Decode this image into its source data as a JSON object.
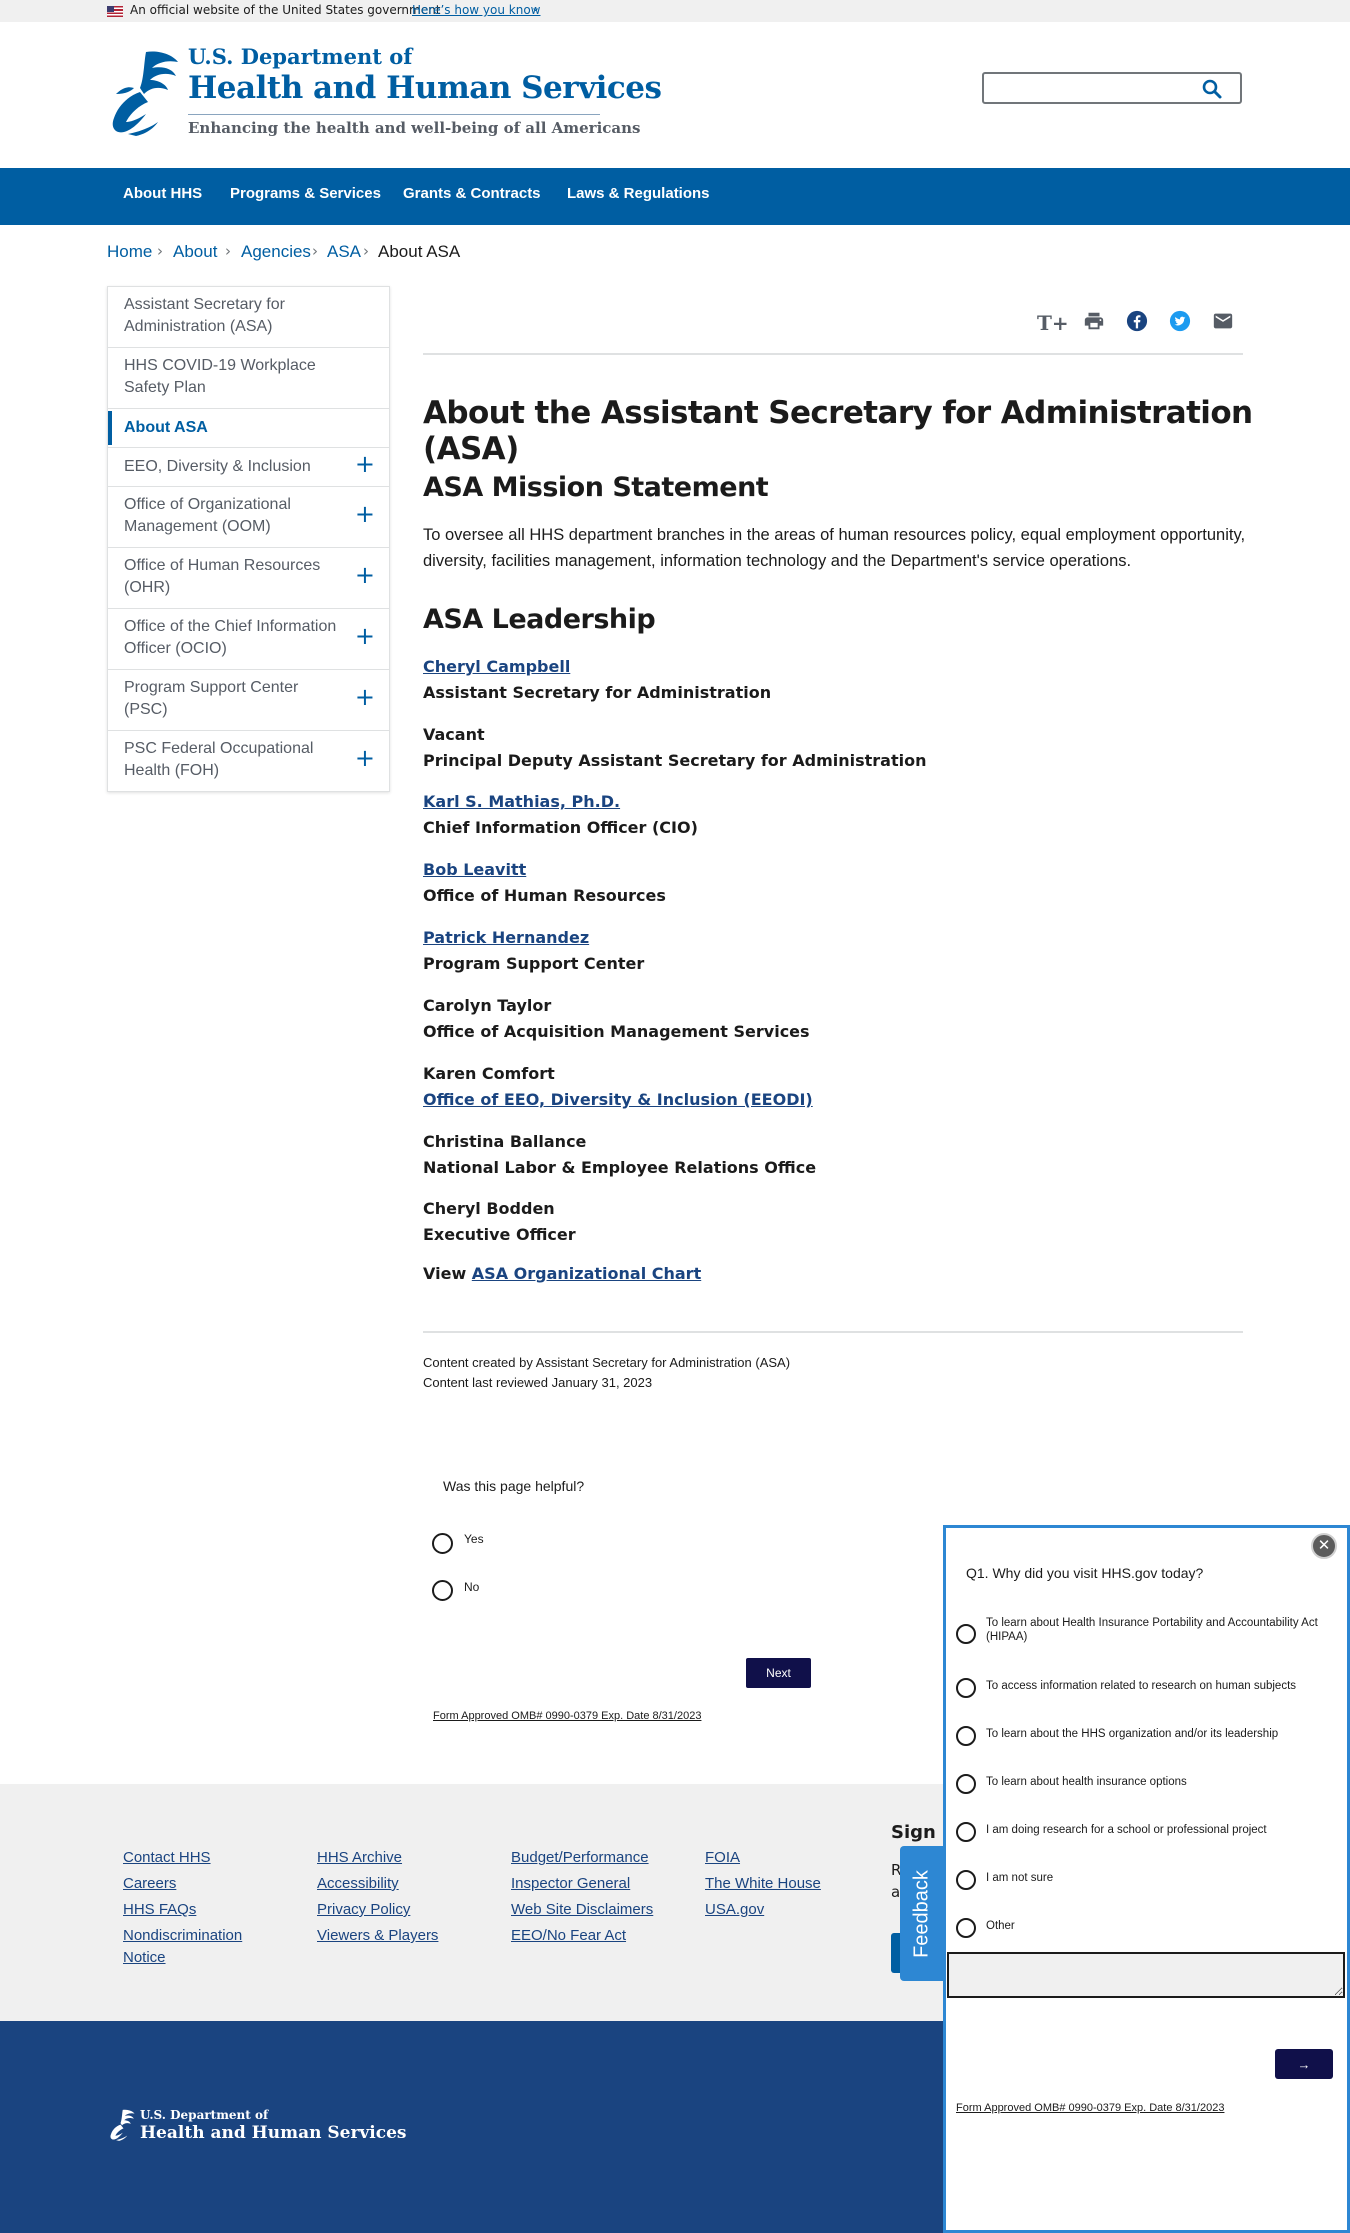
{
  "gov_banner": {
    "text": "An official website of the United States government",
    "link": "Here’s how you know",
    "chevron": "⌄"
  },
  "header": {
    "logo_line1": "U.S. Department of",
    "logo_line2": "Health and Human Services",
    "tagline": "Enhancing the health and well-being of all Americans",
    "search_placeholder": ""
  },
  "nav": {
    "items": [
      "About HHS",
      "Programs & Services",
      "Grants & Contracts",
      "Laws & Regulations"
    ]
  },
  "breadcrumb": {
    "items": [
      "Home",
      "About",
      "Agencies",
      "ASA"
    ],
    "separator": "›",
    "current": "About ASA"
  },
  "sidenav": {
    "items": [
      {
        "label": "Assistant Secretary for Administration (ASA)",
        "expandable": false
      },
      {
        "label": "HHS COVID-19 Workplace Safety Plan",
        "expandable": false
      },
      {
        "label": "About ASA",
        "expandable": false,
        "current": true
      },
      {
        "label": "EEO, Diversity & Inclusion",
        "expandable": true
      },
      {
        "label": "Office of Organizational Management (OOM)",
        "expandable": true
      },
      {
        "label": "Office of Human Resources (OHR)",
        "expandable": true
      },
      {
        "label": "Office of the Chief Information Officer (OCIO)",
        "expandable": true
      },
      {
        "label": "Program Support Center (PSC)",
        "expandable": true
      },
      {
        "label": "PSC Federal Occupational Health (FOH)",
        "expandable": true
      }
    ],
    "plus": "+"
  },
  "tools": {
    "icons": [
      "text-size-icon",
      "print-icon",
      "facebook-icon",
      "twitter-icon",
      "email-icon"
    ],
    "text_size": "T+"
  },
  "article": {
    "title": "About the Assistant Secretary for Administration (ASA)",
    "mission_heading": "ASA Mission Statement",
    "mission_text": "To oversee all HHS department branches in the areas of human resources policy, equal employment opportunity, diversity, facilities management, information technology and the Department's service operations.",
    "leadership_heading": "ASA Leadership",
    "leaders": [
      {
        "name": "Cheryl Campbell",
        "name_link": true,
        "title": "Assistant Secretary for Administration",
        "title_link": false
      },
      {
        "name": "Vacant",
        "name_link": false,
        "title": "Principal Deputy Assistant Secretary for Administration",
        "title_link": false
      },
      {
        "name": "Karl S. Mathias, Ph.D.",
        "name_link": true,
        "title": "Chief Information Officer (CIO)",
        "title_link": false
      },
      {
        "name": "Bob Leavitt",
        "name_link": true,
        "title": "Office of Human Resources",
        "title_link": false
      },
      {
        "name": "Patrick Hernandez",
        "name_link": true,
        "title": "Program Support Center",
        "title_link": false
      },
      {
        "name": "Carolyn Taylor",
        "name_link": false,
        "title": "Office of Acquisition Management Services",
        "title_link": false
      },
      {
        "name": "Karen Comfort",
        "name_link": false,
        "title": "Office of EEO, Diversity & Inclusion (EEODI)",
        "title_link": true
      },
      {
        "name": "Christina Ballance",
        "name_link": false,
        "title": "National Labor & Employee Relations Office",
        "title_link": false
      },
      {
        "name": "Cheryl Bodden",
        "name_link": false,
        "title": "Executive Officer",
        "title_link": false
      }
    ],
    "view_prefix": "View",
    "view_link": "ASA Organizational Chart",
    "created_by": "Content created by Assistant Secretary for Administration (ASA)",
    "last_reviewed": "Content last reviewed January 31, 2023"
  },
  "helpful": {
    "question": "Was this page helpful?",
    "options": [
      "Yes",
      "No"
    ],
    "next": "Next",
    "omb": "Form Approved OMB# 0990-0379 Exp. Date 8/31/2023"
  },
  "footer": {
    "columns": [
      [
        "Contact HHS",
        "Careers",
        "HHS FAQs",
        "Nondiscrimination Notice"
      ],
      [
        "HHS Archive",
        "Accessibility",
        "Privacy Policy",
        "Viewers & Players"
      ],
      [
        "Budget/Performance",
        "Inspector General",
        "Web Site Disclaimers",
        "EEO/No Fear Act"
      ],
      [
        "FOIA",
        "The White House",
        "USA.gov"
      ]
    ],
    "signup_title": "Sign U",
    "signup_text_1": "R",
    "signup_text_2": "ar",
    "logo_line1": "U.S. Department of",
    "logo_line2": "Health and Human Services"
  },
  "feedback_tab": "Feedback",
  "survey": {
    "close": "✕",
    "question": "Q1. Why did you visit HHS.gov today?",
    "options": [
      "To learn about Health Insurance Portability and Accountability Act (HIPAA)",
      "To access information related to research on human subjects",
      "To learn about the HHS organization and/or its leadership",
      "To learn about health insurance options",
      "I am doing research for a school or professional project",
      "I am not sure",
      "Other"
    ],
    "next": "→",
    "omb": "Form Approved OMB# 0990-0379 Exp. Date 8/31/2023"
  },
  "colors": {
    "primary": "#005ea2",
    "link": "#1a4480",
    "footer_dark": "#1a4480",
    "survey_border": "#2d87d3",
    "button_dark": "#10104a"
  }
}
